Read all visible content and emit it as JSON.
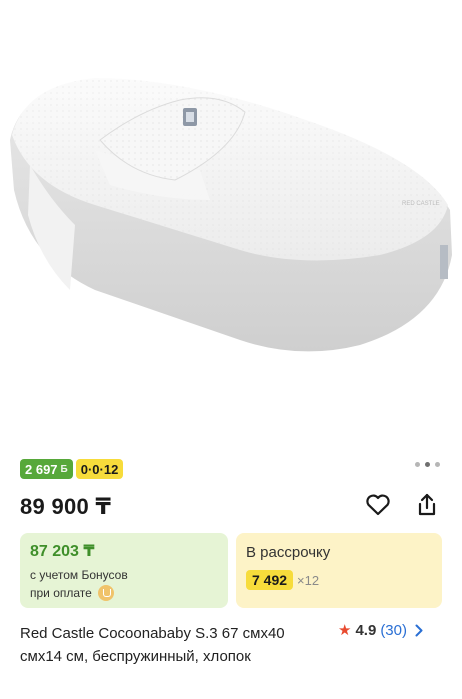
{
  "product": {
    "image_alt": "Red Castle Cocoonababy baby nest",
    "gallery": {
      "total": 3,
      "active": 1
    },
    "badges": {
      "bonus": "2 697",
      "bonus_symbol": "Б",
      "installment": "0·0·12"
    },
    "price": "89 900 ₸",
    "bonus_card": {
      "price": "87 203 ₸",
      "line1": "с учетом Бонусов",
      "line2": "при оплате"
    },
    "installment_card": {
      "title": "В рассрочку",
      "amount": "7 492",
      "months": "×12"
    },
    "title": "Red Castle Cocoonababy S.3 67 смх40 смх14 см, беспружинный, хлопок",
    "rating": {
      "value": "4.9",
      "count": "(30)"
    }
  },
  "colors": {
    "bonus_green": "#57a83a",
    "installment_yellow": "#f7dc3b",
    "star_red": "#e84a2f",
    "link_blue": "#2a6fd4"
  },
  "icons": [
    "star-icon",
    "heart-icon",
    "share-icon",
    "chevron-right-icon",
    "kaspi-icon"
  ]
}
